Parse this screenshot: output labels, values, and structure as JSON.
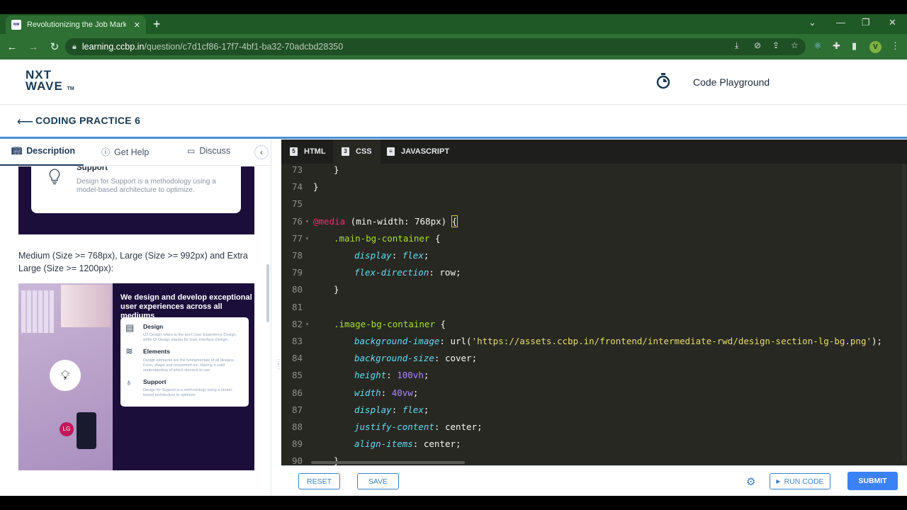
{
  "browser": {
    "tab_title": "Revolutionizing the Job Market |",
    "tab_close": "✕",
    "new_tab": "+",
    "url_host": "learning.ccbp.in",
    "url_path": "/question/c7d1cf86-17f7-4bf1-ba32-70adcbd28350",
    "avatar_letter": "V",
    "favicon_text": "NXT WAVE"
  },
  "header": {
    "logo_line1": "NXT",
    "logo_line2": "WAVE",
    "logo_tm": "TM",
    "playground": "Code Playground"
  },
  "subheader": {
    "title": "CODING PRACTICE 6"
  },
  "left_tabs": [
    {
      "label": "Description",
      "icon": "book-icon"
    },
    {
      "label": "Get Help",
      "icon": "help-icon"
    },
    {
      "label": "Discuss",
      "icon": "chat-icon"
    }
  ],
  "description": {
    "card_title": "Support",
    "card_desc": "Design for Support is a methodology using a model-based architecture to optimize.",
    "medium_text": "Medium (Size >= 768px), Large (Size >= 992px) and Extra Large (Size >= 1200px):",
    "preview_heading": "We design and develop exceptional user experiences across all mediums",
    "preview_items": [
      {
        "title": "Design",
        "desc": "UX Design refers to the term User Experience Design, while UI Design stands for User Interface Design."
      },
      {
        "title": "Elements",
        "desc": "Design elements are the fundamentals of all designs. Form, shape and movement etc. Having a solid understanding of which element to use."
      },
      {
        "title": "Support",
        "desc": "Design for Support is a methodology using a model-based architecture to optimize."
      }
    ],
    "photo_lg": "LG"
  },
  "editor": {
    "tabs": [
      {
        "label": "HTML",
        "icon": "html5-icon",
        "active": false
      },
      {
        "label": "CSS",
        "icon": "css3-icon",
        "active": true
      },
      {
        "label": "JAVASCRIPT",
        "icon": "js-file-icon",
        "active": false
      }
    ],
    "lines": [
      {
        "n": "73",
        "indent": 1,
        "fold": false,
        "tokens": [
          [
            "p",
            "}"
          ]
        ]
      },
      {
        "n": "74",
        "indent": 0,
        "fold": false,
        "tokens": [
          [
            "p",
            "}"
          ]
        ]
      },
      {
        "n": "75",
        "indent": 0,
        "fold": false,
        "tokens": []
      },
      {
        "n": "76",
        "indent": 0,
        "fold": true,
        "tokens": [
          [
            "at",
            "@media"
          ],
          [
            "p",
            " (min-width: 768px) "
          ],
          [
            "hl",
            "{"
          ]
        ]
      },
      {
        "n": "77",
        "indent": 1,
        "fold": true,
        "tokens": [
          [
            "sel",
            ".main-bg-container"
          ],
          [
            "p",
            " {"
          ]
        ]
      },
      {
        "n": "78",
        "indent": 2,
        "fold": false,
        "tokens": [
          [
            "prop",
            "display"
          ],
          [
            "p",
            ": "
          ],
          [
            "kw",
            "flex"
          ],
          [
            "p",
            ";"
          ]
        ]
      },
      {
        "n": "79",
        "indent": 2,
        "fold": false,
        "tokens": [
          [
            "prop",
            "flex-direction"
          ],
          [
            "p",
            ": row;"
          ]
        ]
      },
      {
        "n": "80",
        "indent": 1,
        "fold": false,
        "tokens": [
          [
            "p",
            "}"
          ]
        ]
      },
      {
        "n": "81",
        "indent": 0,
        "fold": false,
        "tokens": []
      },
      {
        "n": "82",
        "indent": 1,
        "fold": true,
        "tokens": [
          [
            "sel",
            ".image-bg-container"
          ],
          [
            "p",
            " {"
          ]
        ]
      },
      {
        "n": "83",
        "indent": 2,
        "fold": false,
        "tokens": [
          [
            "prop",
            "background-image"
          ],
          [
            "p",
            ": url("
          ],
          [
            "str",
            "'https://assets.ccbp.in/frontend/intermediate-rwd/design-section-lg-bg.png'"
          ],
          [
            "p",
            ");"
          ]
        ]
      },
      {
        "n": "84",
        "indent": 2,
        "fold": false,
        "tokens": [
          [
            "prop",
            "background-size"
          ],
          [
            "p",
            ": cover;"
          ]
        ]
      },
      {
        "n": "85",
        "indent": 2,
        "fold": false,
        "tokens": [
          [
            "prop",
            "height"
          ],
          [
            "p",
            ": "
          ],
          [
            "num",
            "100vh"
          ],
          [
            "p",
            ";"
          ]
        ]
      },
      {
        "n": "86",
        "indent": 2,
        "fold": false,
        "tokens": [
          [
            "prop",
            "width"
          ],
          [
            "p",
            ": "
          ],
          [
            "num",
            "40vw"
          ],
          [
            "p",
            ";"
          ]
        ]
      },
      {
        "n": "87",
        "indent": 2,
        "fold": false,
        "tokens": [
          [
            "prop",
            "display"
          ],
          [
            "p",
            ": "
          ],
          [
            "kw",
            "flex"
          ],
          [
            "p",
            ";"
          ]
        ]
      },
      {
        "n": "88",
        "indent": 2,
        "fold": false,
        "tokens": [
          [
            "prop",
            "justify-content"
          ],
          [
            "p",
            ": center;"
          ]
        ]
      },
      {
        "n": "89",
        "indent": 2,
        "fold": false,
        "tokens": [
          [
            "prop",
            "align-items"
          ],
          [
            "p",
            ": center;"
          ]
        ]
      },
      {
        "n": "90",
        "indent": 1,
        "fold": false,
        "tokens": [
          [
            "p",
            "}"
          ]
        ]
      }
    ]
  },
  "bottom": {
    "reset": "RESET",
    "save": "SAVE",
    "run": "RUN CODE",
    "submit": "SUBMIT"
  },
  "colors": {
    "accent": "#3b82f6",
    "browser_green": "#2e6f33",
    "editor_bg": "#272822"
  }
}
